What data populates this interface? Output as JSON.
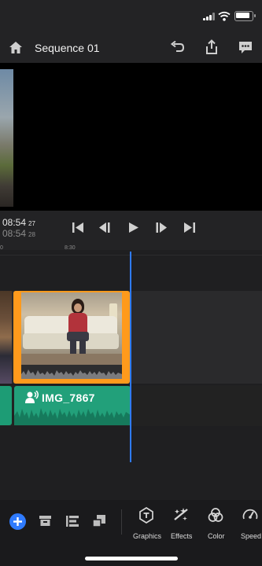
{
  "status_bar": {
    "signal": "signal-icon",
    "wifi": "wifi-icon",
    "battery": "battery-icon"
  },
  "header": {
    "title": "Sequence 01"
  },
  "transport": {
    "current_time": "08:54",
    "current_frame": "27",
    "total_time": "08:54",
    "total_frame": "28"
  },
  "timeline": {
    "ruler_labels": [
      "0",
      "8:30"
    ],
    "audio_clip_name": "IMG_7867"
  },
  "toolbar": {
    "tools": [
      {
        "label": "Graphics",
        "icon": "graphics-icon"
      },
      {
        "label": "Effects",
        "icon": "effects-icon"
      },
      {
        "label": "Color",
        "icon": "color-icon"
      },
      {
        "label": "Speed",
        "icon": "speed-icon"
      }
    ]
  },
  "colors": {
    "accent": "#2f7bff",
    "selection": "#ff9a1c",
    "audio": "#22a07a"
  }
}
